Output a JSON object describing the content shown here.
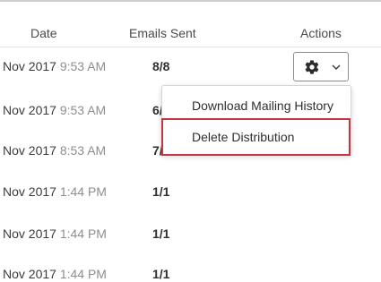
{
  "table": {
    "headers": {
      "date": "Date",
      "emails_sent": "Emails Sent",
      "actions": "Actions"
    },
    "rows": [
      {
        "date": "Nov 2017",
        "time": "9:53 AM",
        "sent": "8/8"
      },
      {
        "date": "Nov 2017",
        "time": "9:53 AM",
        "sent": "6/"
      },
      {
        "date": "Nov 2017",
        "time": "8:53 AM",
        "sent": "7/"
      },
      {
        "date": "Nov 2017",
        "time": "1:44 PM",
        "sent": "1/1"
      },
      {
        "date": "Nov 2017",
        "time": "1:44 PM",
        "sent": "1/1"
      },
      {
        "date": "Nov 2017",
        "time": "1:44 PM",
        "sent": "1/1"
      }
    ]
  },
  "actions_menu": {
    "button_icon": "gear-icon",
    "chevron_icon": "chevron-down-icon",
    "items": [
      {
        "label": "Download Mailing History"
      },
      {
        "label": "Delete Distribution"
      }
    ]
  },
  "colors": {
    "highlight_border": "#c8343f",
    "time_text": "#8e8e8e",
    "header_text": "#4a4a4a"
  }
}
